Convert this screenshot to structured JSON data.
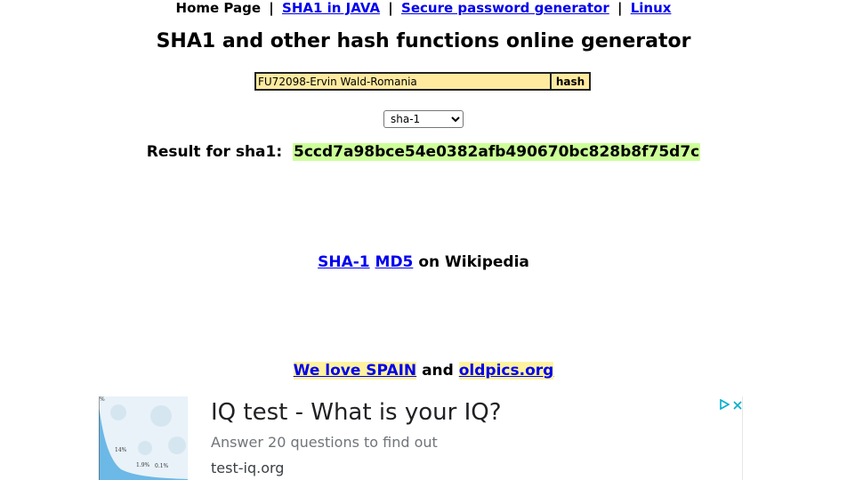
{
  "nav": {
    "home": "Home Page",
    "sep": "|",
    "links": [
      "SHA1 in JAVA",
      "Secure password generator",
      "Linux"
    ]
  },
  "page_title": "SHA1 and other hash functions online generator",
  "form": {
    "input_value": "FU72098-Ervin Wald-Romania",
    "button_label": "hash",
    "algorithm_selected": "sha-1"
  },
  "result": {
    "label": "Result for sha1:",
    "hash": "5ccd7a98bce54e0382afb490670bc828b8f75d7c"
  },
  "wiki": {
    "sha1_link": "SHA-1",
    "md5_link": "MD5",
    "suffix": "on Wikipedia"
  },
  "promo": {
    "link1": "We love SPAIN",
    "joiner": "and",
    "link2": "oldpics.org"
  },
  "ad": {
    "title": "IQ test - What is your IQ?",
    "subtitle": "Answer 20 questions to find out",
    "url": "test-iq.org",
    "thumb_labels": [
      "%",
      "14%",
      "1.9%",
      "0.1%"
    ],
    "icons": [
      "ad-choices-icon",
      "close-icon"
    ]
  },
  "colors": {
    "link": "#0000ee",
    "input_bg": "#ffeaa0",
    "hash_highlight": "#ccff99",
    "ad_choices": "#00aecd"
  }
}
